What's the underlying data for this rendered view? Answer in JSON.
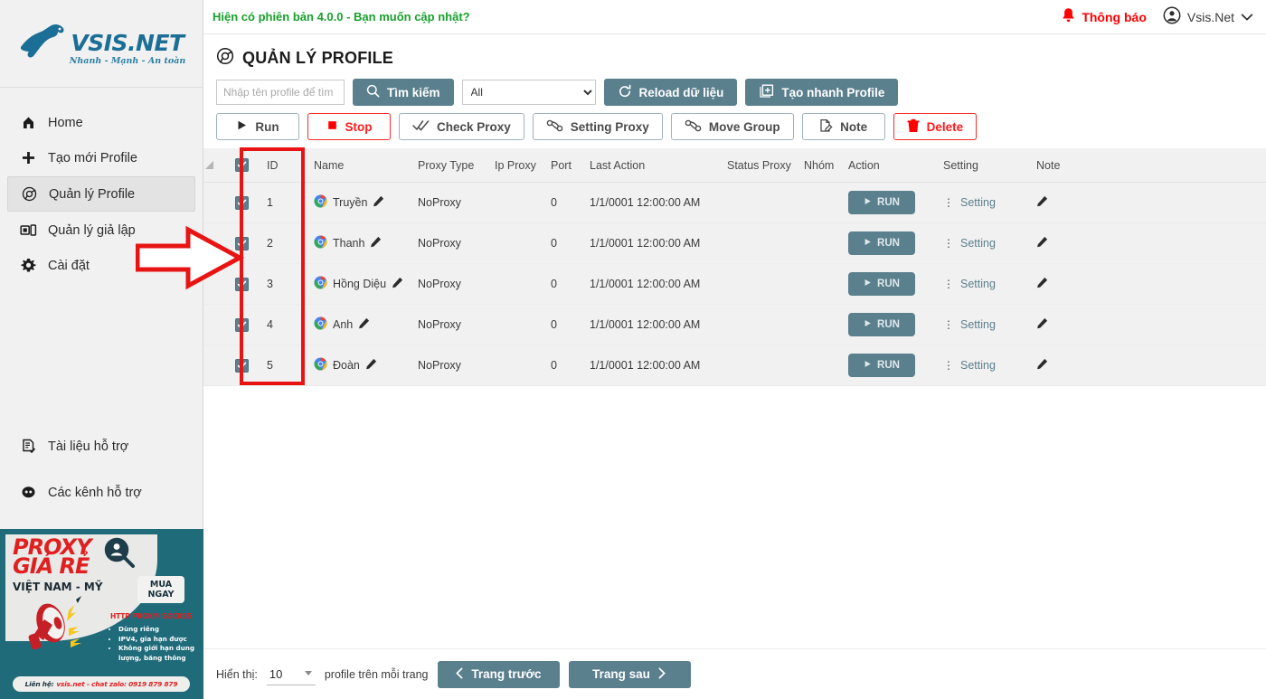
{
  "sidebar": {
    "logo": {
      "main": "VSIS.NET",
      "sub": "Nhanh - Mạnh - An toàn",
      "icon": "vsis-dog-logo-icon"
    },
    "items": [
      {
        "label": "Home",
        "icon": "home-icon"
      },
      {
        "label": "Tạo mới Profile",
        "icon": "plus-icon"
      },
      {
        "label": "Quản lý Profile",
        "icon": "chrome-circle-icon"
      },
      {
        "label": "Quản lý giả lập",
        "icon": "emulator-icon"
      },
      {
        "label": "Cài đặt",
        "icon": "gear-icon"
      }
    ],
    "support": [
      {
        "label": "Tài liệu hỗ trợ",
        "icon": "document-check-icon"
      },
      {
        "label": "Các kênh hỗ trợ",
        "icon": "chat-support-icon"
      }
    ],
    "banner": {
      "title_line1": "PROXY",
      "title_line2": "GIÁ RẺ",
      "subtitle": "VIỆT NAM - MỸ",
      "cta_line1": "MUA",
      "cta_line2": "NGAY",
      "http_label": "HTTP PROXY/ SOCKS5",
      "bullets": [
        "Dùng riêng",
        "IPV4, gia hạn được",
        "Không giới hạn dung lượng, băng thông"
      ],
      "footer_label": "Liên hệ:",
      "footer_contact": "vsis.net - chat zalo: 0919 879 879"
    }
  },
  "topbar": {
    "version_text": "Hiện có phiên bản 4.0.0 - Bạn muốn cập nhật?",
    "notify_label": "Thông báo",
    "user_name": "Vsis.Net"
  },
  "page": {
    "title": "QUẢN LÝ PROFILE",
    "title_icon": "chrome-circle-icon"
  },
  "toolbar": {
    "search_placeholder": "Nhập tên profile để tìm",
    "search_value": "",
    "search_button": "Tìm kiếm",
    "group_selected": "All",
    "group_options": [
      "All"
    ],
    "reload_button": "Reload dữ liệu",
    "quick_create_button": "Tạo nhanh Profile",
    "actions": [
      {
        "label": "Run",
        "icon": "play-icon",
        "style": "outline"
      },
      {
        "label": "Stop",
        "icon": "stop-square-icon",
        "style": "outline-danger"
      },
      {
        "label": "Check Proxy",
        "icon": "double-check-icon",
        "style": "outline"
      },
      {
        "label": "Setting Proxy",
        "icon": "proxy-link-icon",
        "style": "outline"
      },
      {
        "label": "Move Group",
        "icon": "proxy-link-icon",
        "style": "outline"
      },
      {
        "label": "Note",
        "icon": "note-edit-icon",
        "style": "outline"
      },
      {
        "label": "Delete",
        "icon": "trash-icon",
        "style": "outline-danger"
      }
    ]
  },
  "table": {
    "columns": [
      "ID",
      "Name",
      "Proxy Type",
      "Ip Proxy",
      "Port",
      "Last Action",
      "Status Proxy",
      "Nhóm",
      "Action",
      "Setting",
      "Note"
    ],
    "header_checkbox_checked": true,
    "rows": [
      {
        "checked": true,
        "id": "1",
        "name": "Truyền",
        "proxy_type": "NoProxy",
        "ip_proxy": "",
        "port": "0",
        "last_action": "1/1/0001 12:00:00 AM",
        "status_proxy": "",
        "group": "",
        "action": "RUN",
        "setting": "Setting"
      },
      {
        "checked": true,
        "id": "2",
        "name": "Thanh",
        "proxy_type": "NoProxy",
        "ip_proxy": "",
        "port": "0",
        "last_action": "1/1/0001 12:00:00 AM",
        "status_proxy": "",
        "group": "",
        "action": "RUN",
        "setting": "Setting"
      },
      {
        "checked": true,
        "id": "3",
        "name": "Hồng Diệu",
        "proxy_type": "NoProxy",
        "ip_proxy": "",
        "port": "0",
        "last_action": "1/1/0001 12:00:00 AM",
        "status_proxy": "",
        "group": "",
        "action": "RUN",
        "setting": "Setting"
      },
      {
        "checked": true,
        "id": "4",
        "name": "Anh",
        "proxy_type": "NoProxy",
        "ip_proxy": "",
        "port": "0",
        "last_action": "1/1/0001 12:00:00 AM",
        "status_proxy": "",
        "group": "",
        "action": "RUN",
        "setting": "Setting"
      },
      {
        "checked": true,
        "id": "5",
        "name": "Đoàn",
        "proxy_type": "NoProxy",
        "ip_proxy": "",
        "port": "0",
        "last_action": "1/1/0001 12:00:00 AM",
        "status_proxy": "",
        "group": "",
        "action": "RUN",
        "setting": "Setting"
      }
    ]
  },
  "footer": {
    "show_label": "Hiển thị:",
    "page_size": "10",
    "page_size_options": [
      "10"
    ],
    "per_page_label": "profile trên mỗi trang",
    "prev_button": "Trang trước",
    "next_button": "Trang sau"
  },
  "colors": {
    "accent_teal": "#5a7f8d",
    "danger_red": "#ff1a1a",
    "version_green": "#18a02c",
    "annotation_red": "#e81414",
    "banner_bg": "#1f6b7a"
  }
}
